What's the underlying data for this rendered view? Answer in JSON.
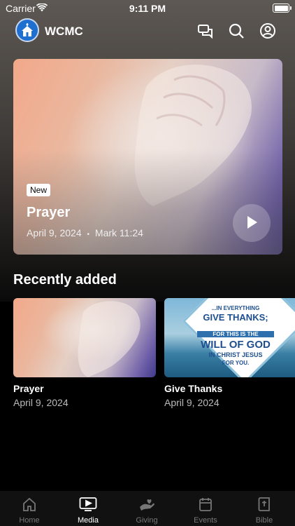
{
  "status": {
    "carrier": "Carrier",
    "time": "9:11 PM"
  },
  "header": {
    "title": "WCMC"
  },
  "hero": {
    "badge": "New",
    "title": "Prayer",
    "date": "April 9, 2024",
    "reference": "Mark 11:24",
    "separator": "•"
  },
  "recent": {
    "title": "Recently added",
    "items": [
      {
        "title": "Prayer",
        "date": "April 9, 2024"
      },
      {
        "title": "Give Thanks",
        "date": "April 9, 2024",
        "art_lines": [
          "...IN EVERYTHING",
          "GIVE THANKS;",
          "FOR THIS IS THE",
          "WILL OF GOD",
          "IN CHRIST JESUS",
          "FOR YOU."
        ]
      }
    ]
  },
  "tabs": [
    {
      "label": "Home",
      "icon": "home-icon"
    },
    {
      "label": "Media",
      "icon": "media-icon",
      "active": true
    },
    {
      "label": "Giving",
      "icon": "giving-icon"
    },
    {
      "label": "Events",
      "icon": "calendar-icon"
    },
    {
      "label": "Bible",
      "icon": "bible-icon"
    }
  ],
  "colors": {
    "accent": "#1f6fd1",
    "background": "#000000",
    "tab_inactive": "#777777"
  }
}
